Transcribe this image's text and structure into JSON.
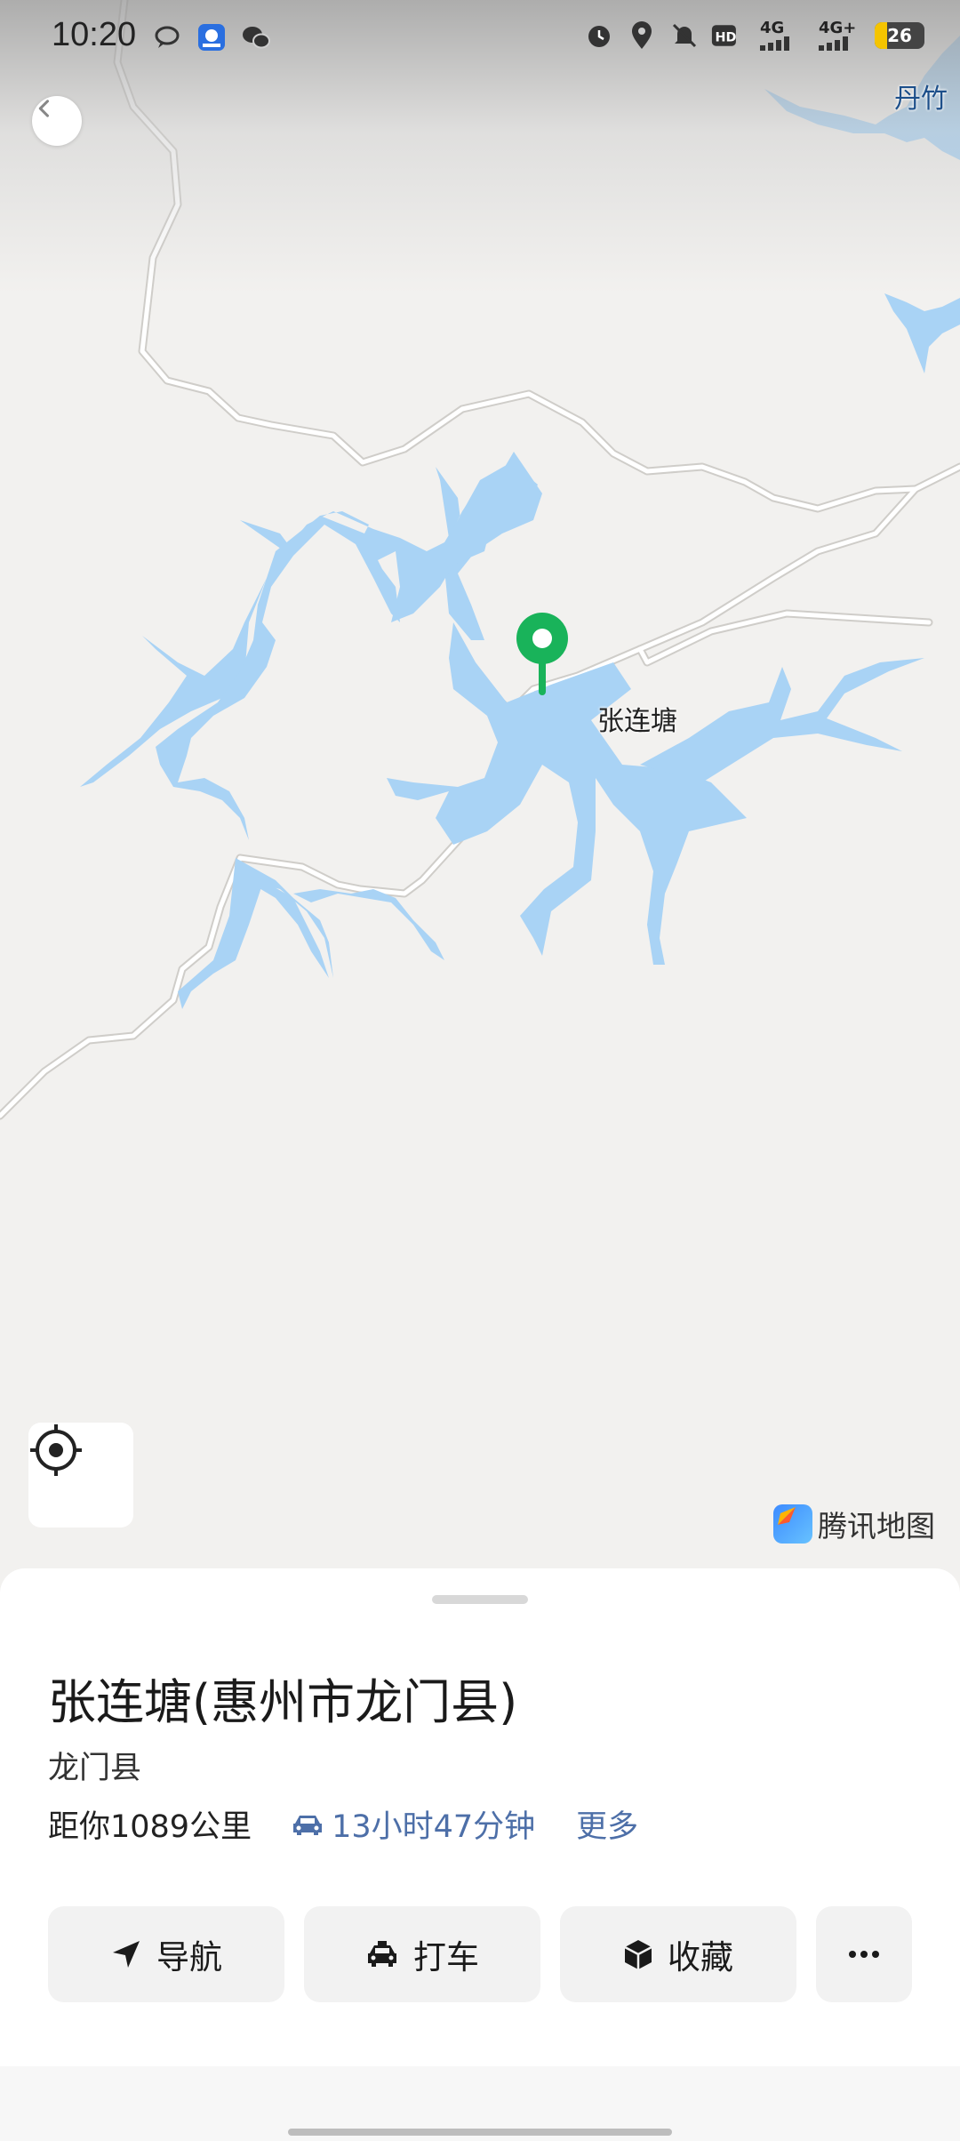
{
  "status_bar": {
    "time": "10:20",
    "left_icons": [
      "chat-bubble-icon",
      "baidu-app-icon",
      "wechat-icon"
    ],
    "right_icons": [
      "alarm-icon",
      "location-icon",
      "mute-icon",
      "hd-icon"
    ],
    "network_1": "4G",
    "network_2": "4G+",
    "battery": "26"
  },
  "map": {
    "place_label": "张连塘",
    "edge_label": "丹竹",
    "provider": "腾讯地图",
    "pin_color": "#19b35a",
    "water_color": "#a9d3f5",
    "road_color": "#ffffff"
  },
  "place": {
    "title": "张连塘(惠州市龙门县)",
    "district": "龙门县",
    "distance": "距你1089公里",
    "drive_time": "13小时47分钟",
    "more": "更多"
  },
  "actions": {
    "navigate": "导航",
    "taxi": "打车",
    "favorite": "收藏",
    "more_icon": "more-dots-icon"
  },
  "colors": {
    "accent_blue": "#4d6fa8",
    "button_bg": "#f2f2f2"
  }
}
